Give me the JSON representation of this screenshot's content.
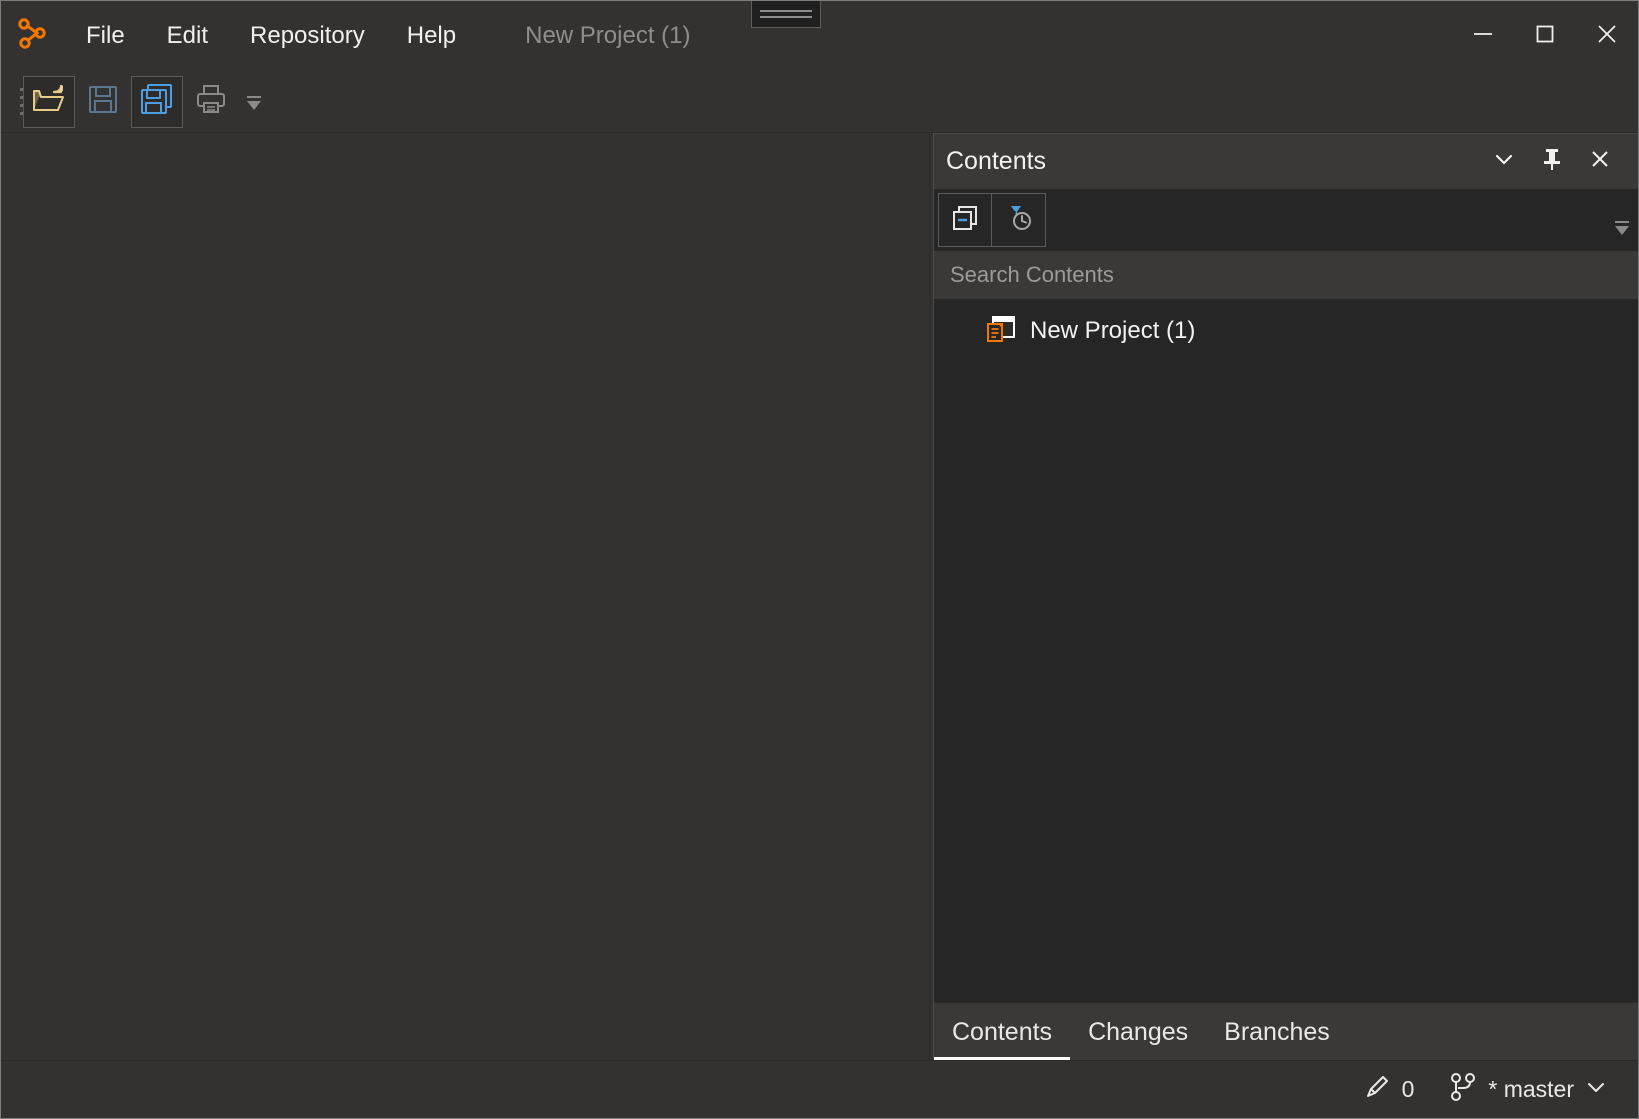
{
  "window": {
    "app_logo_icon": "node-graph-logo-icon",
    "document_title": "New Project (1)",
    "drag_handle_icon": "drag-grip-icon",
    "controls": {
      "minimize_icon": "minimize-icon",
      "maximize_icon": "maximize-icon",
      "close_icon": "close-icon"
    }
  },
  "menubar": {
    "items": [
      {
        "label": "File"
      },
      {
        "label": "Edit"
      },
      {
        "label": "Repository"
      },
      {
        "label": "Help"
      }
    ]
  },
  "toolbar": {
    "handle_icon": "toolbar-drag-handle-icon",
    "buttons": [
      {
        "name": "open-project",
        "icon": "open-folder-icon",
        "framed": true
      },
      {
        "name": "save",
        "icon": "save-icon",
        "framed": false
      },
      {
        "name": "save-as",
        "icon": "save-as-icon",
        "framed": true
      },
      {
        "name": "print",
        "icon": "print-icon",
        "framed": false
      }
    ],
    "overflow_icon": "toolbar-overflow-chevron-icon"
  },
  "panel": {
    "title": "Contents",
    "header_actions": [
      {
        "name": "panel-menu",
        "icon": "chevron-down-icon"
      },
      {
        "name": "panel-pin",
        "icon": "pin-icon"
      },
      {
        "name": "panel-close",
        "icon": "close-icon"
      }
    ],
    "toolbar_buttons": [
      {
        "name": "collapse-all",
        "icon": "collapse-all-icon"
      },
      {
        "name": "filter-history",
        "icon": "filter-clock-icon"
      }
    ],
    "toolbar_overflow_icon": "panel-overflow-chevron-icon",
    "search": {
      "placeholder": "Search Contents",
      "value": ""
    },
    "tree": {
      "items": [
        {
          "label": "New Project (1)",
          "icon": "project-document-icon"
        }
      ]
    },
    "tabs": [
      {
        "label": "Contents",
        "active": true
      },
      {
        "label": "Changes",
        "active": false
      },
      {
        "label": "Branches",
        "active": false
      }
    ]
  },
  "statusbar": {
    "edits": {
      "icon": "pencil-icon",
      "count": "0"
    },
    "branch": {
      "icon": "git-branch-icon",
      "label": "* master",
      "chevron_icon": "chevron-down-icon"
    }
  },
  "colors": {
    "accent_orange": "#f07800",
    "accent_blue": "#4d9de0",
    "chrome_bg": "#333230",
    "panel_bg": "#262626",
    "header_bg": "#3a3937"
  }
}
